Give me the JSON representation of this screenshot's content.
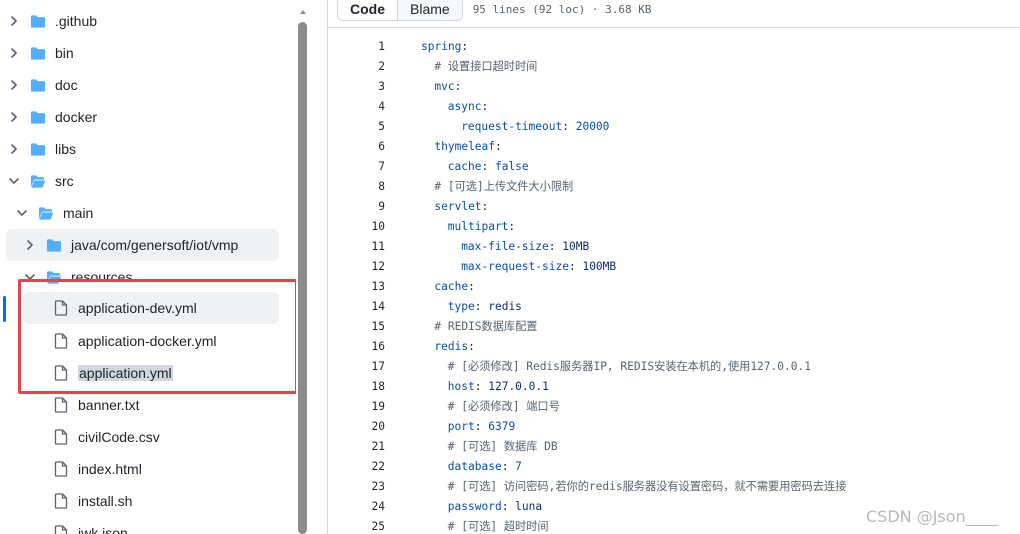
{
  "tree": {
    "items": [
      {
        "name": ".github",
        "type": "folder",
        "expanded": false,
        "depth": 0
      },
      {
        "name": "bin",
        "type": "folder",
        "expanded": false,
        "depth": 0
      },
      {
        "name": "doc",
        "type": "folder",
        "expanded": false,
        "depth": 0
      },
      {
        "name": "docker",
        "type": "folder",
        "expanded": false,
        "depth": 0
      },
      {
        "name": "libs",
        "type": "folder",
        "expanded": false,
        "depth": 0
      },
      {
        "name": "src",
        "type": "folder",
        "expanded": true,
        "depth": 0
      },
      {
        "name": "main",
        "type": "folder",
        "expanded": true,
        "depth": 1
      },
      {
        "name": "java/com/genersoft/iot/vmp",
        "type": "folder",
        "expanded": false,
        "depth": 2
      },
      {
        "name": "resources",
        "type": "folder",
        "expanded": true,
        "depth": 2
      },
      {
        "name": "application-dev.yml",
        "type": "file",
        "depth": 3
      },
      {
        "name": "application-docker.yml",
        "type": "file",
        "depth": 3
      },
      {
        "name": "application.yml",
        "type": "file",
        "depth": 3
      },
      {
        "name": "banner.txt",
        "type": "file",
        "depth": 3
      },
      {
        "name": "civilCode.csv",
        "type": "file",
        "depth": 3
      },
      {
        "name": "index.html",
        "type": "file",
        "depth": 3
      },
      {
        "name": "install.sh",
        "type": "file",
        "depth": 3
      },
      {
        "name": "jwk.json",
        "type": "file",
        "depth": 3
      }
    ]
  },
  "viewer": {
    "code_tab": "Code",
    "blame_tab": "Blame",
    "meta": "95 lines (92 loc) · 3.68 KB"
  },
  "code": {
    "lines": [
      {
        "n": "1",
        "indent": 0,
        "key": "spring",
        "sep": ":",
        "val": "",
        "vtype": ""
      },
      {
        "n": "2",
        "indent": 1,
        "comment": "# 设置接口超时时间"
      },
      {
        "n": "3",
        "indent": 1,
        "key": "mvc",
        "sep": ":",
        "val": "",
        "vtype": ""
      },
      {
        "n": "4",
        "indent": 2,
        "key": "async",
        "sep": ":",
        "val": "",
        "vtype": ""
      },
      {
        "n": "5",
        "indent": 3,
        "key": "request-timeout",
        "sep": ": ",
        "val": "20000",
        "vtype": "n"
      },
      {
        "n": "6",
        "indent": 1,
        "key": "thymeleaf",
        "sep": ":",
        "val": "",
        "vtype": ""
      },
      {
        "n": "7",
        "indent": 2,
        "key": "cache",
        "sep": ": ",
        "val": "false",
        "vtype": "n"
      },
      {
        "n": "8",
        "indent": 1,
        "comment": "# [可选]上传文件大小限制"
      },
      {
        "n": "9",
        "indent": 1,
        "key": "servlet",
        "sep": ":",
        "val": "",
        "vtype": ""
      },
      {
        "n": "10",
        "indent": 2,
        "key": "multipart",
        "sep": ":",
        "val": "",
        "vtype": ""
      },
      {
        "n": "11",
        "indent": 3,
        "key": "max-file-size",
        "sep": ": ",
        "val": "10MB",
        "vtype": "v"
      },
      {
        "n": "12",
        "indent": 3,
        "key": "max-request-size",
        "sep": ": ",
        "val": "100MB",
        "vtype": "v"
      },
      {
        "n": "13",
        "indent": 1,
        "key": "cache",
        "sep": ":",
        "val": "",
        "vtype": ""
      },
      {
        "n": "14",
        "indent": 2,
        "key": "type",
        "sep": ": ",
        "val": "redis",
        "vtype": "v"
      },
      {
        "n": "15",
        "indent": 1,
        "comment": "# REDIS数据库配置"
      },
      {
        "n": "16",
        "indent": 1,
        "key": "redis",
        "sep": ":",
        "val": "",
        "vtype": ""
      },
      {
        "n": "17",
        "indent": 2,
        "comment": "# [必须修改] Redis服务器IP, REDIS安装在本机的,使用127.0.0.1"
      },
      {
        "n": "18",
        "indent": 2,
        "key": "host",
        "sep": ": ",
        "val": "127.0.0.1",
        "vtype": "v"
      },
      {
        "n": "19",
        "indent": 2,
        "comment": "# [必须修改] 端口号"
      },
      {
        "n": "20",
        "indent": 2,
        "key": "port",
        "sep": ": ",
        "val": "6379",
        "vtype": "n"
      },
      {
        "n": "21",
        "indent": 2,
        "comment": "# [可选] 数据库 DB"
      },
      {
        "n": "22",
        "indent": 2,
        "key": "database",
        "sep": ": ",
        "val": "7",
        "vtype": "n"
      },
      {
        "n": "23",
        "indent": 2,
        "comment": "# [可选] 访问密码,若你的redis服务器没有设置密码，就不需要用密码去连接"
      },
      {
        "n": "24",
        "indent": 2,
        "key": "password",
        "sep": ": ",
        "val": "luna",
        "vtype": "v"
      },
      {
        "n": "25",
        "indent": 2,
        "comment": "# [可选] 超时时间"
      }
    ]
  },
  "watermark": "CSDN @Json____",
  "colors": {
    "folder": "#54aeff",
    "highlight_box": "#e0464c",
    "keyword": "#0550ae",
    "string": "#0a3069",
    "comment": "#59636e",
    "accent": "#0969da"
  }
}
